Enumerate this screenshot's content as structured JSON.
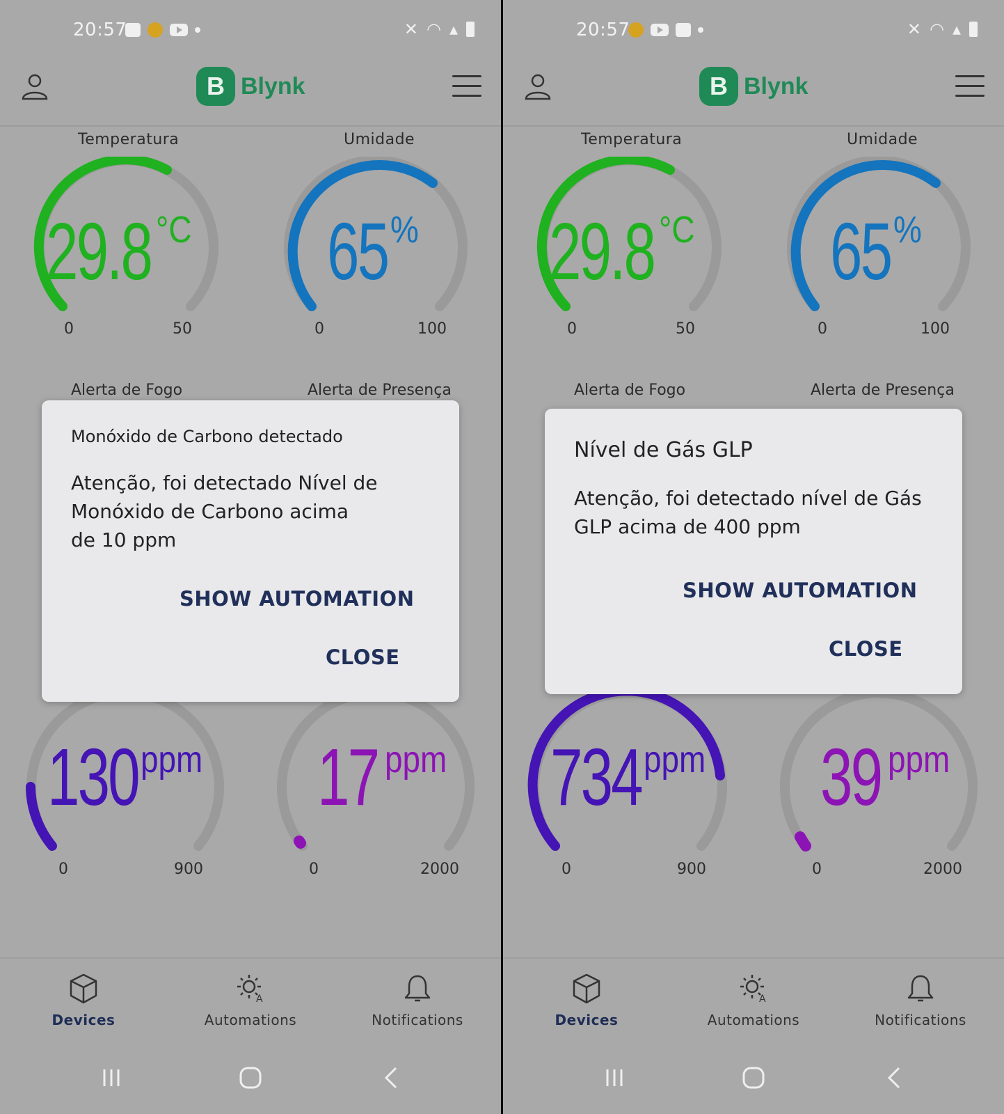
{
  "colors": {
    "bg": "#a9a9a9",
    "brand": "#1f8a56",
    "temp": "#1fb11f",
    "humid": "#1474bd",
    "co": "#4414b4",
    "gas": "#8c14b4",
    "track": "#9a9a9a",
    "button_text": "#20305a"
  },
  "screens": [
    {
      "status": {
        "time": "20:57"
      },
      "header": {
        "logo_letter": "B",
        "logo_text": "Blynk"
      },
      "gauges": {
        "temp": {
          "label": "Temperatura",
          "value": "29.8",
          "unit": "°C",
          "min": "0",
          "max": "50"
        },
        "humid": {
          "label": "Umidade",
          "value": "65",
          "unit": "%",
          "min": "0",
          "max": "100"
        },
        "co": {
          "value": "130",
          "unit": "ppm",
          "min": "0",
          "max": "900"
        },
        "gas": {
          "value": "17",
          "unit": "ppm",
          "min": "0",
          "max": "2000"
        }
      },
      "alerts": {
        "fire": "Alerta de Fogo",
        "presence": "Alerta de Presença"
      },
      "dialog": {
        "title": "Monóxido de Carbono  detectado",
        "body_line1": "Atenção, foi detectado Nível de",
        "body_line2": "Monóxido de Carbono acima",
        "body_line3": "de 10 ppm",
        "show_automation": "SHOW AUTOMATION",
        "close": "CLOSE"
      },
      "nav": {
        "devices": "Devices",
        "automations": "Automations",
        "notifications": "Notifications"
      }
    },
    {
      "status": {
        "time": "20:57"
      },
      "header": {
        "logo_letter": "B",
        "logo_text": "Blynk"
      },
      "gauges": {
        "temp": {
          "label": "Temperatura",
          "value": "29.8",
          "unit": "°C",
          "min": "0",
          "max": "50"
        },
        "humid": {
          "label": "Umidade",
          "value": "65",
          "unit": "%",
          "min": "0",
          "max": "100"
        },
        "co": {
          "value": "734",
          "unit": "ppm",
          "min": "0",
          "max": "900"
        },
        "gas": {
          "value": "39",
          "unit": "ppm",
          "min": "0",
          "max": "2000"
        }
      },
      "alerts": {
        "fire": "Alerta de Fogo",
        "presence": "Alerta de Presença"
      },
      "dialog": {
        "title": "Nível  de Gás GLP",
        "body_line1": "Atenção, foi detectado nível de Gás",
        "body_line2": "GLP acima de 400 ppm",
        "show_automation": "SHOW AUTOMATION",
        "close": "CLOSE"
      },
      "nav": {
        "devices": "Devices",
        "automations": "Automations",
        "notifications": "Notifications"
      }
    }
  ]
}
